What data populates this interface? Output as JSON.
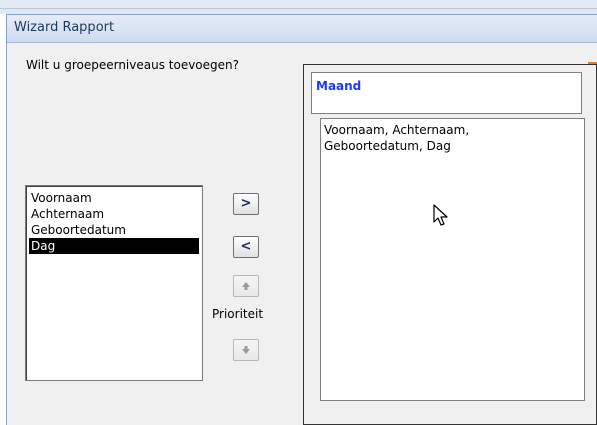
{
  "window": {
    "title": "Wizard Rapport",
    "prompt": "Wilt u groepeerniveaus toevoegen?"
  },
  "fields": {
    "items": [
      "Voornaam",
      "Achternaam",
      "Geboortedatum",
      "Dag"
    ],
    "selected": "Dag"
  },
  "buttons": {
    "add_label": ">",
    "remove_label": "<",
    "priority_up_icon": "arrow-up-icon",
    "priority_down_icon": "arrow-down-icon",
    "priority_label": "Prioriteit"
  },
  "preview": {
    "group_level": "Maand",
    "detail_line1": "Voornaam, Achternaam,",
    "detail_line2": "Geboortedatum, Dag"
  },
  "colors": {
    "group_text": "#1a3aff",
    "selection_bg": "#000000"
  }
}
